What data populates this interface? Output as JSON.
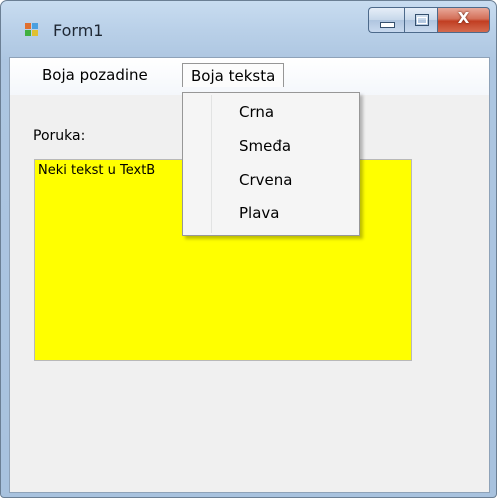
{
  "window": {
    "title": "Form1",
    "close_glyph": "X",
    "icons": {
      "app": "form-app-icon",
      "minimize": "minimize-icon",
      "maximize": "maximize-icon",
      "close": "close-icon"
    }
  },
  "menu": {
    "items": [
      {
        "label": "Boja pozadine"
      },
      {
        "label": "Boja teksta"
      }
    ],
    "dropdown": [
      "Crna",
      "Smeđa",
      "Crvena",
      "Plava"
    ]
  },
  "form": {
    "label": "Poruka:",
    "textbox_value": "Neki tekst u TextB",
    "textbox_bg": "#ffff00"
  }
}
